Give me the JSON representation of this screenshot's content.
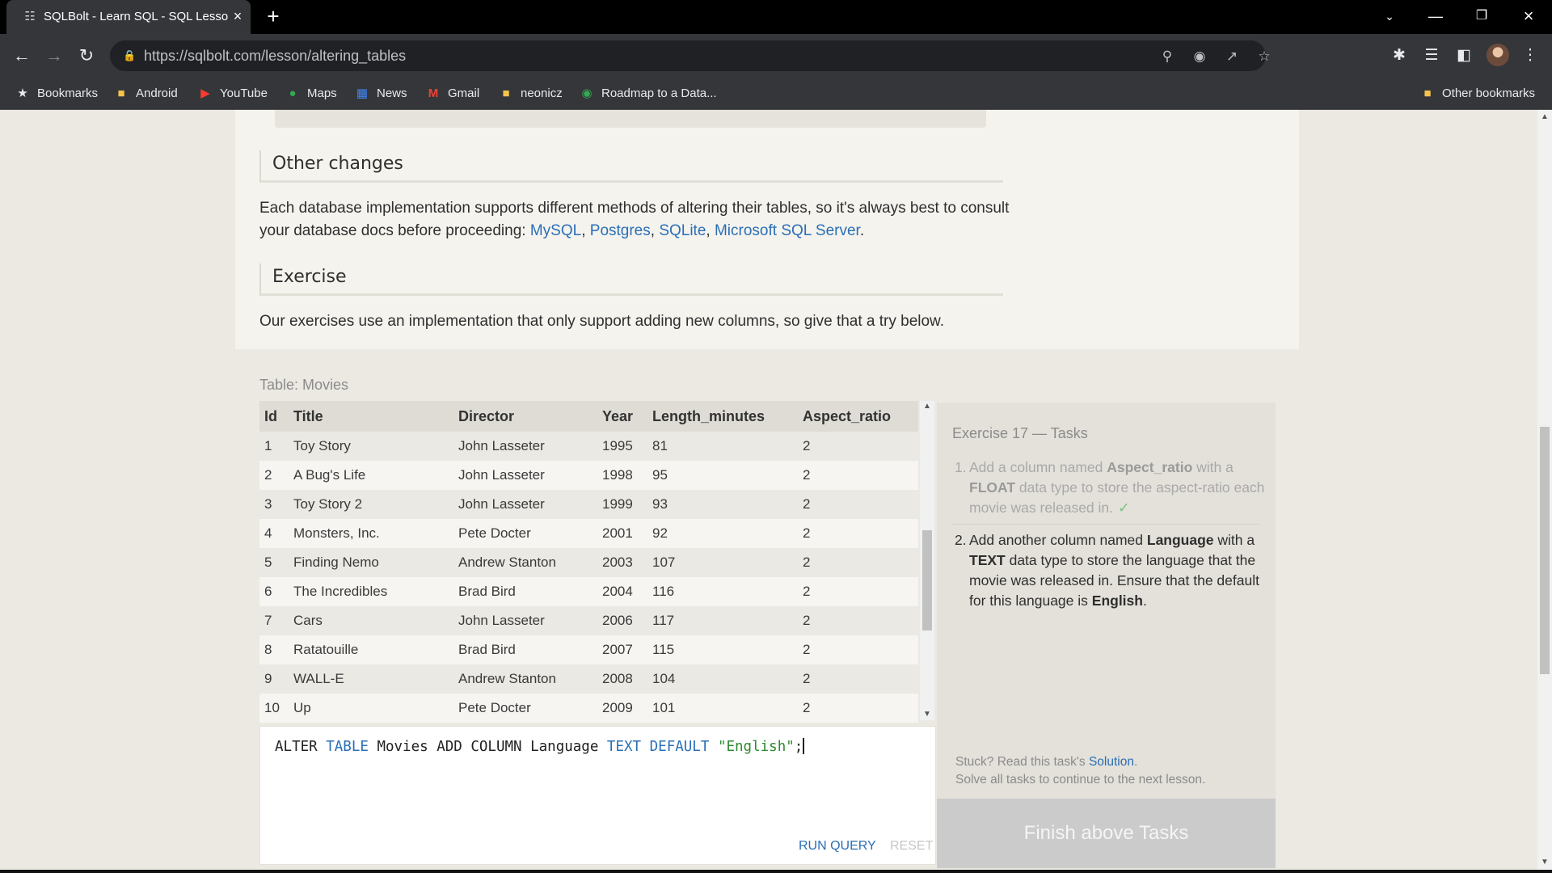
{
  "browser": {
    "tab_title": "SQLBolt - Learn SQL - SQL Lesson",
    "url": "https://sqlbolt.com/lesson/altering_tables",
    "bookmarks": [
      {
        "label": "Bookmarks",
        "icon": "star-icon"
      },
      {
        "label": "Android",
        "icon": "folder-icon"
      },
      {
        "label": "YouTube",
        "icon": "youtube-icon"
      },
      {
        "label": "Maps",
        "icon": "maps-icon"
      },
      {
        "label": "News",
        "icon": "news-icon"
      },
      {
        "label": "Gmail",
        "icon": "gmail-icon"
      },
      {
        "label": "neonicz",
        "icon": "folder-icon"
      },
      {
        "label": "Roadmap to a Data...",
        "icon": "roadmap-icon"
      }
    ],
    "other_bookmarks": "Other bookmarks"
  },
  "lesson": {
    "other_changes_heading": "Other changes",
    "other_changes_text": "Each database implementation supports different methods of altering their tables, so it's always best to consult your database docs before proceeding:",
    "doc_links": [
      "MySQL",
      "Postgres",
      "SQLite",
      "Microsoft SQL Server"
    ],
    "exercise_heading": "Exercise",
    "exercise_text": "Our exercises use an implementation that only support adding new columns, so give that a try below."
  },
  "table": {
    "caption": "Table: Movies",
    "columns": [
      "Id",
      "Title",
      "Director",
      "Year",
      "Length_minutes",
      "Aspect_ratio"
    ],
    "rows": [
      [
        "1",
        "Toy Story",
        "John Lasseter",
        "1995",
        "81",
        "2"
      ],
      [
        "2",
        "A Bug's Life",
        "John Lasseter",
        "1998",
        "95",
        "2"
      ],
      [
        "3",
        "Toy Story 2",
        "John Lasseter",
        "1999",
        "93",
        "2"
      ],
      [
        "4",
        "Monsters, Inc.",
        "Pete Docter",
        "2001",
        "92",
        "2"
      ],
      [
        "5",
        "Finding Nemo",
        "Andrew Stanton",
        "2003",
        "107",
        "2"
      ],
      [
        "6",
        "The Incredibles",
        "Brad Bird",
        "2004",
        "116",
        "2"
      ],
      [
        "7",
        "Cars",
        "John Lasseter",
        "2006",
        "117",
        "2"
      ],
      [
        "8",
        "Ratatouille",
        "Brad Bird",
        "2007",
        "115",
        "2"
      ],
      [
        "9",
        "WALL-E",
        "Andrew Stanton",
        "2008",
        "104",
        "2"
      ],
      [
        "10",
        "Up",
        "Pete Docter",
        "2009",
        "101",
        "2"
      ]
    ]
  },
  "editor": {
    "query_tokens": [
      {
        "t": "ALTER ",
        "k": "plain"
      },
      {
        "t": "TABLE",
        "k": "kw"
      },
      {
        "t": " Movies ADD COLUMN Language ",
        "k": "plain"
      },
      {
        "t": "TEXT",
        "k": "kw"
      },
      {
        "t": " ",
        "k": "plain"
      },
      {
        "t": "DEFAULT",
        "k": "kw"
      },
      {
        "t": " ",
        "k": "plain"
      },
      {
        "t": "\"English\"",
        "k": "str"
      },
      {
        "t": ";",
        "k": "plain"
      }
    ],
    "run_label": "RUN QUERY",
    "reset_label": "RESET"
  },
  "tasks": {
    "title": "Exercise 17 — Tasks",
    "task1": {
      "n": "1.",
      "a": "Add a column named ",
      "b1": "Aspect_ratio",
      "c": " with a ",
      "b2": "FLOAT",
      "d": " data type to store the aspect-ratio each movie was released in.",
      "check": "✓"
    },
    "task2": {
      "n": "2.",
      "a": "Add another column named ",
      "b1": "Language",
      "c": " with a ",
      "b2": "TEXT",
      "d": " data type to store the language that the movie was released in. Ensure that the default for this language is ",
      "b3": "English",
      "e": "."
    },
    "stuck_prefix": "Stuck? Read this task's ",
    "solution_link": "Solution",
    "stuck_suffix": ".",
    "solve_all": "Solve all tasks to continue to the next lesson.",
    "finish_label": "Finish above Tasks"
  }
}
